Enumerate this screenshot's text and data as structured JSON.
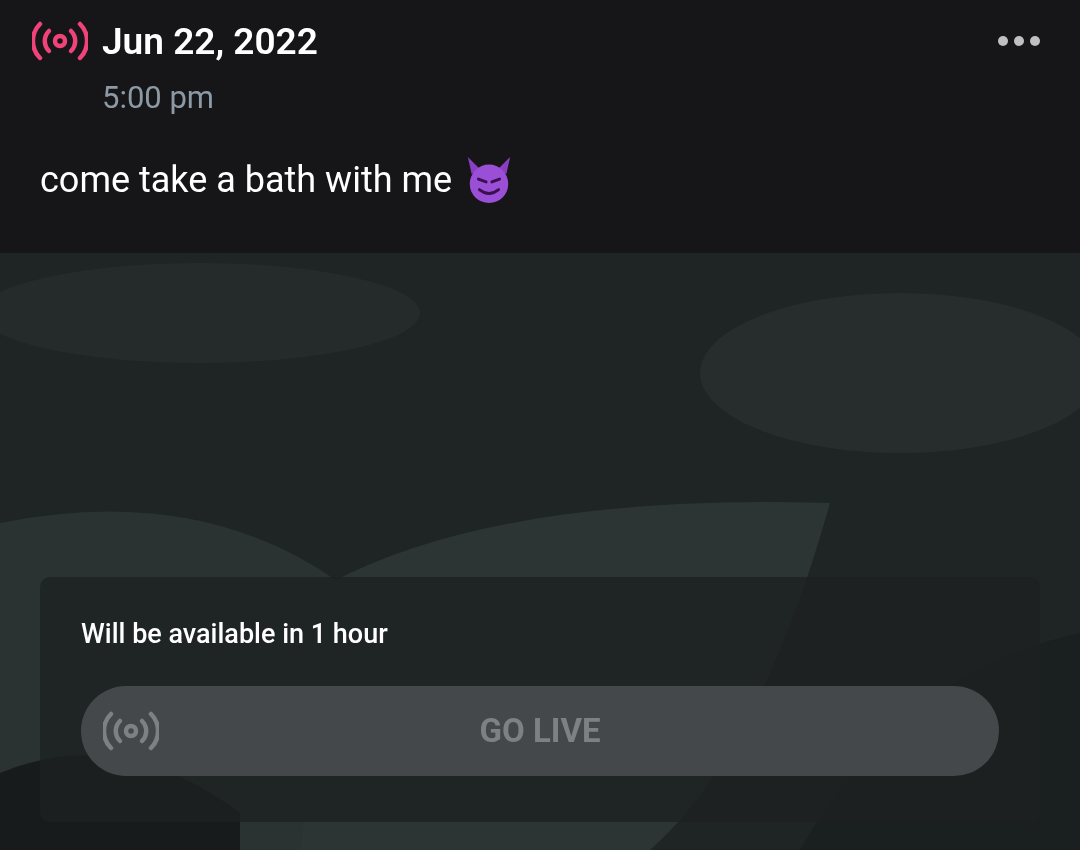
{
  "post": {
    "date": "Jun 22, 2022",
    "time": "5:00 pm",
    "message": "come take a bath with me"
  },
  "live_card": {
    "notice": "Will be available in 1 hour",
    "button": {
      "label": "GO LIVE",
      "disabled": true
    }
  }
}
